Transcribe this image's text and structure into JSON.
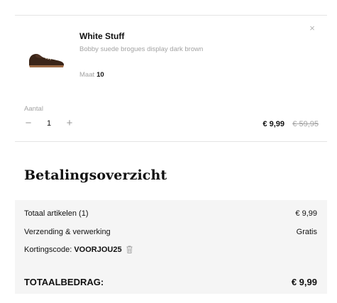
{
  "cart_item": {
    "brand": "White Stuff",
    "description": "Bobby suede brogues display dark brown",
    "size_label": "Maat",
    "size_value": "10",
    "image_icon": "shoe-icon",
    "remove_icon": "close-icon",
    "quantity_label": "Aantal",
    "quantity_minus": "−",
    "quantity_value": "1",
    "quantity_plus": "+",
    "price_current": "€ 9,99",
    "price_original": "€ 59,95"
  },
  "summary": {
    "title": "Betalingsoverzicht",
    "rows": [
      {
        "label": "Totaal artikelen (1)",
        "value": "€ 9,99"
      },
      {
        "label": "Verzending & verwerking",
        "value": "Gratis"
      }
    ],
    "discount_label": "Kortingscode:",
    "discount_code": "VOORJOU25",
    "discount_remove_icon": "trash-icon",
    "total_label": "TOTAALBEDRAG:",
    "total_value": "€ 9,99"
  },
  "colors": {
    "text": "#111111",
    "muted": "#a3a3a3",
    "panel": "#f5f5f5",
    "divider": "#e4e4e4"
  }
}
